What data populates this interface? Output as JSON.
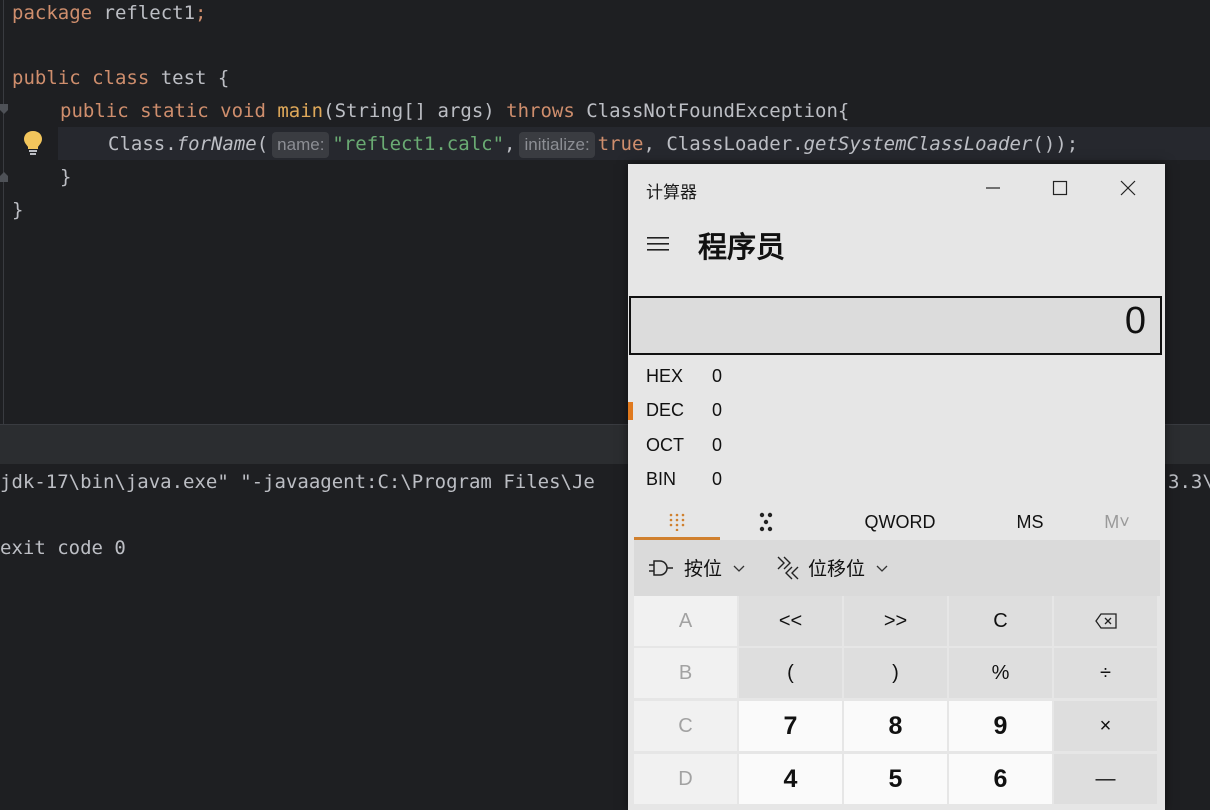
{
  "editor": {
    "line1": {
      "kw": "package",
      "name": " reflect1",
      "semi": ";"
    },
    "line2": {
      "kw1": "public",
      "kw2": " class",
      "name": " test {"
    },
    "line3": {
      "kw1": "public",
      "kw2": " static",
      "kw3": " void",
      "method": " main",
      "params": "(String[] args) ",
      "throws": "throws",
      "exc": " ClassNotFoundException{"
    },
    "line4": {
      "cls": "Class.",
      "method": "forName",
      "paren": "(",
      "hint1": "name:",
      "arg1": "\"reflect1.calc\"",
      "comma": ",",
      "hint2": "initialize:",
      "arg2": "true",
      "rest1": ", ClassLoader.",
      "method2": "getSystemClassLoader",
      "rest2": "());"
    },
    "line5": "}",
    "line6": "}"
  },
  "console": {
    "line1": "jdk-17\\bin\\java.exe\" \"-javaagent:C:\\Program Files\\Je",
    "line1_tail": "3.3\\",
    "line2": "exit code 0"
  },
  "calculator": {
    "window_title": "计算器",
    "mode": "程序员",
    "display_value": "0",
    "radix": [
      {
        "label": "HEX",
        "value": "0",
        "active": false
      },
      {
        "label": "DEC",
        "value": "0",
        "active": true
      },
      {
        "label": "OCT",
        "value": "0",
        "active": false
      },
      {
        "label": "BIN",
        "value": "0",
        "active": false
      }
    ],
    "tabs": {
      "qword": "QWORD",
      "ms": "MS",
      "mplus": "M˅"
    },
    "bitops": {
      "bitwise": "按位",
      "shift": "位移位"
    },
    "keys": {
      "r1": [
        "A",
        "<<",
        ">>",
        "C",
        "⌫"
      ],
      "r2": [
        "B",
        "(",
        ")",
        "%",
        "÷"
      ],
      "r3": [
        "C",
        "7",
        "8",
        "9",
        "×"
      ],
      "r4": [
        "D",
        "4",
        "5",
        "6",
        "—"
      ]
    },
    "accent": "#e07a1f"
  }
}
